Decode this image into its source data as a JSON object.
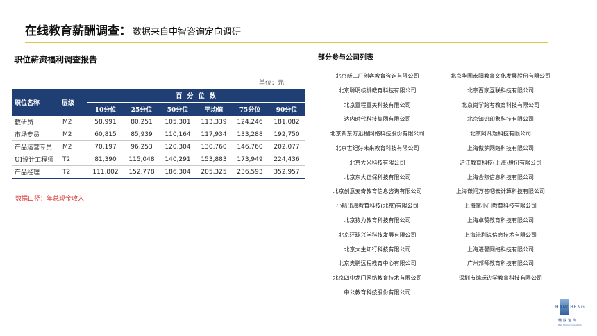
{
  "header": {
    "title": "在线教育薪酬调查：",
    "subtitle": "数据来自中智咨询定向调研"
  },
  "report": {
    "title": "职位薪资福利调查报告",
    "unit": "单位：元",
    "columns": {
      "position": "职位名称",
      "level": "层级",
      "percentile_group": "百 分 位 数",
      "p10": "10分位",
      "p25": "25分位",
      "p50": "50分位",
      "mean": "平均值",
      "p75": "75分位",
      "p90": "90分位"
    },
    "rows": [
      {
        "position": "教研员",
        "level": "M2",
        "p10": "58,991",
        "p25": "80,251",
        "p50": "105,301",
        "mean": "113,339",
        "p75": "124,246",
        "p90": "181,082"
      },
      {
        "position": "市场专员",
        "level": "M2",
        "p10": "60,815",
        "p25": "85,939",
        "p50": "110,164",
        "mean": "117,934",
        "p75": "133,288",
        "p90": "192,750"
      },
      {
        "position": "产品运营专员",
        "level": "M2",
        "p10": "70,197",
        "p25": "96,253",
        "p50": "120,304",
        "mean": "130,760",
        "p75": "146,760",
        "p90": "202,077"
      },
      {
        "position": "UI设计工程师",
        "level": "T2",
        "p10": "81,390",
        "p25": "115,048",
        "p50": "140,291",
        "mean": "153,883",
        "p75": "173,949",
        "p90": "224,436"
      },
      {
        "position": "产品经理",
        "level": "T2",
        "p10": "111,802",
        "p25": "152,778",
        "p50": "186,304",
        "mean": "205,325",
        "p75": "236,593",
        "p90": "352,957"
      }
    ],
    "note": "数据口径：年总现金收入",
    "header_color": "#1e3e74",
    "note_color": "#d9322c"
  },
  "companies": {
    "title": "部分参与公司列表",
    "list": [
      "北京新工厂创客教育咨询有限公司",
      "北京华图宏阳教育文化发展股份有限公司",
      "北京聪明核桃教育科技有限公司",
      "北京百家互联科技有限公司",
      "北京童程童美科技有限公司",
      "北京尚学跨考教育科技有限公司",
      "达内时代科技集团有限公司",
      "北京知识印象科技有限公司",
      "北京新东方迅程网络科技股份有限公司",
      "北京阿凡题科技有限公司",
      "北京世纪好未来教育科技有限公司",
      "上海傲梦网络科技有限公司",
      "北京大米科技有限公司",
      "沪江教育科技(上海)股份有限公司",
      "北京东大正保科技有限公司",
      "上海合煦信息科技有限公司",
      "北京创意麦奇教育信息咨询有限公司",
      "上海谦问万答吧云计算科技有限公司",
      "小船出海教育科技(北京)有限公司",
      "上海掌小门教育科技有限公司",
      "北京猿力教育科技有限公司",
      "上海卓赞教育科技有限公司",
      "北京环球兴学科技发展有限公司",
      "上海流利说信息技术有限公司",
      "北京大生知行科技有限公司",
      "上海进馨网络科技有限公司",
      "北京奥鹏远程教育中心有限公司",
      "广州邦师教育科技有限公司",
      "北京四中龙门网络教育技术有限公司",
      "深圳市编玩边学教育科技有限公司",
      "中公教育科技股份有限公司",
      "……"
    ]
  },
  "logo": {
    "wordmark": "HANCHENG",
    "cn": "翰成咨询",
    "en": "Han Cheng Consulting"
  },
  "accent_color": "#e3c24a"
}
